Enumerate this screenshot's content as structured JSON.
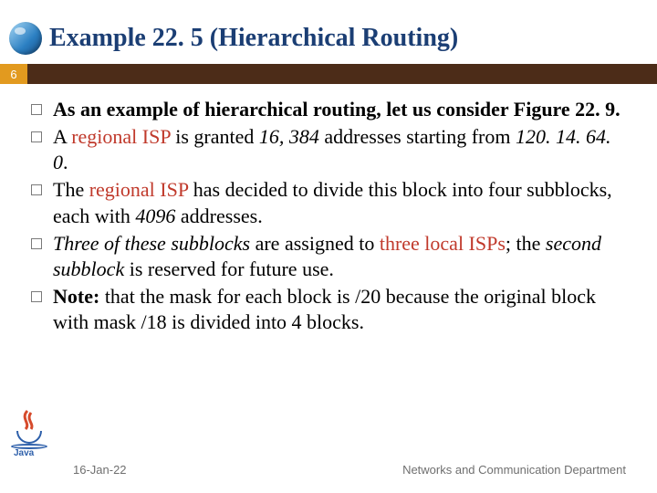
{
  "page_number": "6",
  "title": "Example 22. 5 (Hierarchical Routing)",
  "bullets": [
    {
      "html": "<span class='b'>As an example of hierarchical routing, let us consider Figure 22. 9.</span>"
    },
    {
      "html": "A <span class='red'>regional ISP</span> is granted <span class='i'>16, 384</span> addresses starting from <span class='i'>120. 14. 64. 0</span>."
    },
    {
      "html": "The <span class='red'>regional ISP</span> has decided to divide this block into four subblocks, each with <span class='i'>4096</span> addresses."
    },
    {
      "html": "<span class='i'>Three of these subblocks</span> are assigned to <span class='red'>three local ISPs</span>; the <span class='i'>second subblock</span> is reserved for future use."
    },
    {
      "html": "<span class='b'>Note:</span> that the mask for each block is /20 because the original block with mask /18 is divided into 4 blocks."
    }
  ],
  "footer": {
    "date": "16-Jan-22",
    "dept": "Networks and Communication Department"
  },
  "icons": {
    "globe": "globe-icon",
    "java": "java-logo-icon"
  }
}
